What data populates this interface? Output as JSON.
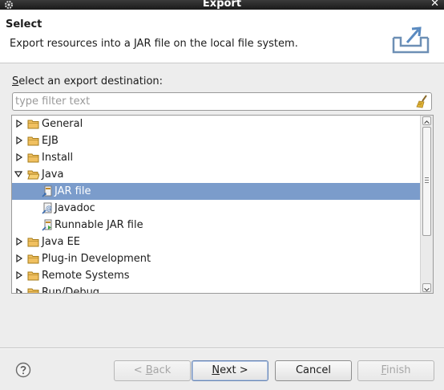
{
  "window": {
    "title": "Export",
    "close_glyph": "✕"
  },
  "header": {
    "title": "Select",
    "description": "Export resources into a JAR file on the local file system.",
    "icon": "export-wizard-icon"
  },
  "destination": {
    "label_mnemonic": "S",
    "label_rest": "elect an export destination:"
  },
  "filter": {
    "placeholder": "type filter text",
    "value": "",
    "clear_icon": "broom-icon"
  },
  "tree": {
    "items": [
      {
        "label": "General",
        "type": "folder",
        "expanded": false,
        "level": 0
      },
      {
        "label": "EJB",
        "type": "folder",
        "expanded": false,
        "level": 0
      },
      {
        "label": "Install",
        "type": "folder",
        "expanded": false,
        "level": 0
      },
      {
        "label": "Java",
        "type": "folder",
        "expanded": true,
        "level": 0
      },
      {
        "label": "JAR file",
        "type": "jar",
        "level": 1,
        "selected": true
      },
      {
        "label": "Javadoc",
        "type": "javadoc",
        "level": 1
      },
      {
        "label": "Runnable JAR file",
        "type": "jar",
        "level": 1
      },
      {
        "label": "Java EE",
        "type": "folder",
        "expanded": false,
        "level": 0
      },
      {
        "label": "Plug-in Development",
        "type": "folder",
        "expanded": false,
        "level": 0
      },
      {
        "label": "Remote Systems",
        "type": "folder",
        "expanded": false,
        "level": 0
      },
      {
        "label": "Run/Debug",
        "type": "folder",
        "expanded": false,
        "level": 0
      }
    ]
  },
  "buttons": {
    "back": {
      "pre": "< ",
      "mnemonic": "B",
      "rest": "ack",
      "enabled": false
    },
    "next": {
      "mnemonic": "N",
      "rest": "ext >",
      "enabled": true
    },
    "cancel": {
      "label": "Cancel",
      "enabled": true
    },
    "finish": {
      "mnemonic": "F",
      "rest": "inish",
      "enabled": false
    }
  },
  "colors": {
    "selection": "#7b9ccb",
    "folder": "#e8b04a"
  }
}
